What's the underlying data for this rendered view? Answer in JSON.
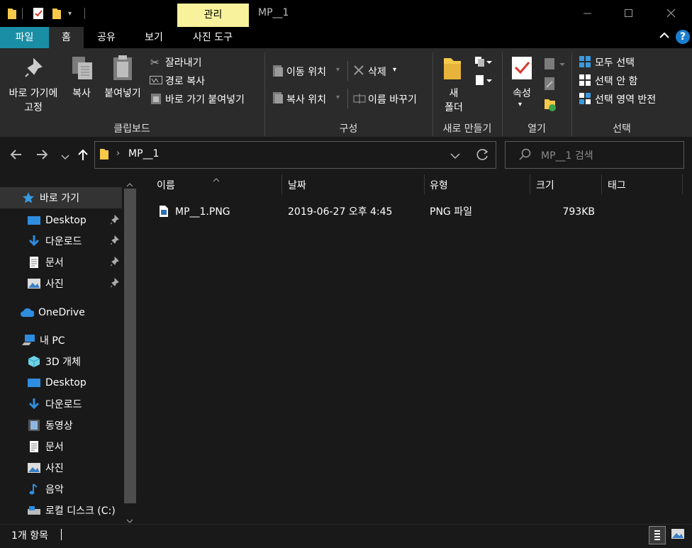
{
  "window": {
    "title": "MP__1",
    "contextual_tab": "관리"
  },
  "tabs": {
    "file": "파일",
    "home": "홈",
    "share": "공유",
    "view": "보기",
    "picture_tools": "사진 도구"
  },
  "ribbon": {
    "clipboard": {
      "pin_line1": "바로 가기에",
      "pin_line2": "고정",
      "copy": "복사",
      "paste": "붙여넣기",
      "cut": "잘라내기",
      "copy_path": "경로 복사",
      "paste_shortcut": "바로 가기 붙여넣기",
      "label": "클립보드"
    },
    "organize": {
      "move_to": "이동 위치",
      "delete": "삭제",
      "copy_to": "복사 위치",
      "rename": "이름 바꾸기",
      "label": "구성"
    },
    "new": {
      "new_folder_line1": "새",
      "new_folder_line2": "폴더",
      "label": "새로 만들기"
    },
    "open": {
      "properties": "속성",
      "label": "열기"
    },
    "select": {
      "select_all": "모두 선택",
      "select_none": "선택 안 함",
      "invert": "선택 영역 반전",
      "label": "선택"
    }
  },
  "address": {
    "path": "MP__1",
    "search_placeholder": "MP__1 검색"
  },
  "nav": {
    "quick_access": "바로 가기",
    "quick_items": [
      "Desktop",
      "다운로드",
      "문서",
      "사진"
    ],
    "onedrive": "OneDrive",
    "this_pc": "내 PC",
    "pc_items": [
      "3D 개체",
      "Desktop",
      "다운로드",
      "동영상",
      "문서",
      "사진",
      "음악",
      "로컬 디스크 (C:)"
    ]
  },
  "columns": {
    "name": "이름",
    "date": "날짜",
    "type": "유형",
    "size": "크기",
    "tags": "태그"
  },
  "files": [
    {
      "name": "MP__1.PNG",
      "date": "2019-06-27 오후 4:45",
      "type": "PNG 파일",
      "size": "793KB"
    }
  ],
  "status": {
    "count": "1개 항목"
  },
  "colors": {
    "accent": "#1a8ea5",
    "contextual": "#f7f29b",
    "ribbon": "#2b2b2b",
    "pane": "#191919"
  }
}
